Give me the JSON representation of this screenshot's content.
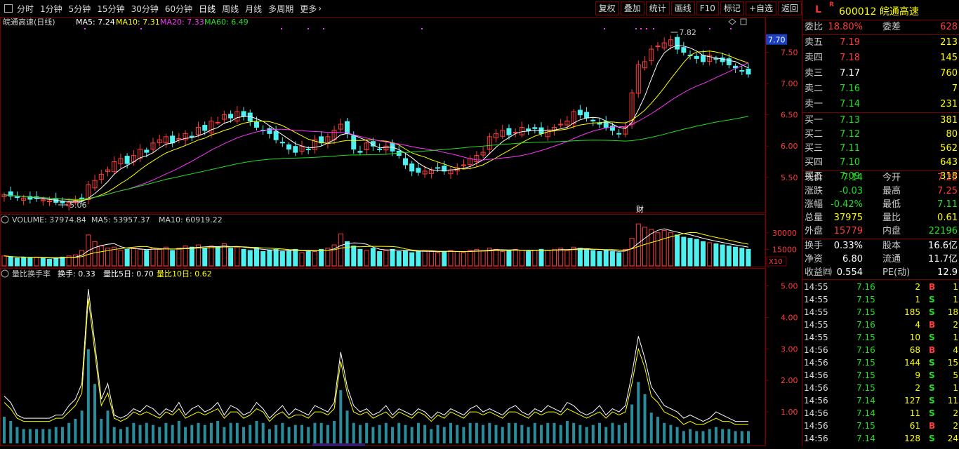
{
  "toolbar": {
    "periods": [
      "分时",
      "1分钟",
      "5分钟",
      "15分钟",
      "30分钟",
      "60分钟",
      "日线",
      "周线",
      "月线",
      "多周期",
      "更多"
    ],
    "active": "日线",
    "more_icon": "chevron-right-icon",
    "actions": [
      "复权",
      "叠加",
      "统计",
      "画线",
      "F10",
      "标记",
      "+自选",
      "返回"
    ]
  },
  "main_chart": {
    "legend_title": "皖通高速(日线)",
    "ma5": "MA5: 7.24",
    "ma10": "MA10: 7.31",
    "ma20": "MA20: 7.33",
    "ma60": "MA60: 6.49",
    "high_label": "7.82",
    "low_label": "5.06",
    "current_price_tag": "7.70",
    "yticks": [
      "7.50",
      "7.00",
      "6.50",
      "6.00",
      "5.50"
    ],
    "marker": "财",
    "colors": {
      "up": "#ff3b3b",
      "down": "#4ff0f0",
      "ma5": "#ffffff",
      "ma10": "#ffff00",
      "ma20": "#ff33ff",
      "ma60": "#22dd22"
    }
  },
  "volume_chart": {
    "legend_title": "VOLUME: 37974.84",
    "ma5": "MA5: 53957.37",
    "ma10": "MA10: 60919.22",
    "yticks": [
      "30000",
      "15000"
    ],
    "unit": "X10"
  },
  "ratio_chart": {
    "legend_title": "量比换手率",
    "turnover": "换手: 0.33",
    "ratio5": "量比5日: 0.70",
    "ratio10": "量比10日: 0.62",
    "yticks": [
      "5.00",
      "4.00",
      "3.00",
      "2.00",
      "1.00"
    ]
  },
  "quote": {
    "flag": "L",
    "r_mark": "R",
    "code_name": "600012 皖通高速",
    "weibi_label": "委比",
    "weibi": "18.80%",
    "weicha_label": "委差",
    "weicha": "628",
    "asks": [
      {
        "label": "卖五",
        "price": "7.19",
        "vol": "213",
        "color": "red"
      },
      {
        "label": "卖四",
        "price": "7.18",
        "vol": "145",
        "color": "red"
      },
      {
        "label": "卖三",
        "price": "7.17",
        "vol": "760",
        "color": "white"
      },
      {
        "label": "卖二",
        "price": "7.16",
        "vol": "7",
        "color": "green"
      },
      {
        "label": "卖一",
        "price": "7.14",
        "vol": "231",
        "color": "green"
      }
    ],
    "bids": [
      {
        "label": "买一",
        "price": "7.13",
        "vol": "381",
        "color": "green"
      },
      {
        "label": "买二",
        "price": "7.12",
        "vol": "80",
        "color": "green"
      },
      {
        "label": "买三",
        "price": "7.11",
        "vol": "562",
        "color": "green"
      },
      {
        "label": "买四",
        "price": "7.10",
        "vol": "643",
        "color": "green"
      },
      {
        "label": "买五",
        "price": "7.09",
        "vol": "318",
        "color": "green"
      }
    ],
    "stats": [
      {
        "a": "现价",
        "b": "7.14",
        "bc": "green",
        "c": "今开",
        "d": "7.22",
        "dc": "red"
      },
      {
        "a": "涨跌",
        "b": "-0.03",
        "bc": "green",
        "c": "最高",
        "d": "7.25",
        "dc": "red"
      },
      {
        "a": "涨幅",
        "b": "-0.42%",
        "bc": "green",
        "c": "最低",
        "d": "7.11",
        "dc": "green"
      },
      {
        "a": "总量",
        "b": "37975",
        "bc": "yellow",
        "c": "量比",
        "d": "0.61",
        "dc": "yellow"
      },
      {
        "a": "外盘",
        "b": "15779",
        "bc": "red",
        "c": "内盘",
        "d": "22196",
        "dc": "green"
      }
    ],
    "fundamentals": [
      {
        "a": "换手",
        "b": "0.33%",
        "c": "股本",
        "d": "16.6亿"
      },
      {
        "a": "净资",
        "b": "6.80",
        "c": "流通",
        "d": "11.7亿"
      },
      {
        "a": "收益㈣",
        "b": "0.554",
        "c": "PE(动)",
        "d": "12.9"
      }
    ],
    "ticks": [
      {
        "t": "14:55",
        "p": "7.16",
        "v": "2",
        "s": "B",
        "n": "1"
      },
      {
        "t": "14:55",
        "p": "7.15",
        "v": "1",
        "s": "S",
        "n": "1"
      },
      {
        "t": "14:55",
        "p": "7.15",
        "v": "185",
        "s": "S",
        "n": "18"
      },
      {
        "t": "14:55",
        "p": "7.16",
        "v": "4",
        "s": "B",
        "n": "2"
      },
      {
        "t": "14:55",
        "p": "7.15",
        "v": "10",
        "s": "S",
        "n": "1"
      },
      {
        "t": "14:56",
        "p": "7.16",
        "v": "68",
        "s": "B",
        "n": "4"
      },
      {
        "t": "14:56",
        "p": "7.15",
        "v": "144",
        "s": "S",
        "n": "15"
      },
      {
        "t": "14:56",
        "p": "7.15",
        "v": "9",
        "s": "S",
        "n": "5"
      },
      {
        "t": "14:56",
        "p": "7.15",
        "v": "2",
        "s": "S",
        "n": "1"
      },
      {
        "t": "14:56",
        "p": "7.14",
        "v": "127",
        "s": "S",
        "n": "11"
      },
      {
        "t": "14:56",
        "p": "7.14",
        "v": "11",
        "s": "S",
        "n": "2"
      },
      {
        "t": "14:56",
        "p": "7.15",
        "v": "61",
        "s": "B",
        "n": "2"
      },
      {
        "t": "14:56",
        "p": "7.14",
        "v": "128",
        "s": "S",
        "n": "24"
      }
    ]
  },
  "chart_data": {
    "type": "candlestick",
    "ylim": [
      5.06,
      7.82
    ],
    "ma_values": {
      "MA5": 7.24,
      "MA10": 7.31,
      "MA20": 7.33,
      "MA60": 6.49
    },
    "close": [
      5.22,
      5.2,
      5.18,
      5.17,
      5.15,
      5.16,
      5.14,
      5.12,
      5.1,
      5.09,
      5.1,
      5.12,
      5.15,
      5.38,
      5.45,
      5.55,
      5.62,
      5.75,
      5.8,
      5.72,
      5.85,
      5.95,
      5.9,
      6.05,
      6.1,
      6.15,
      6.05,
      6.12,
      6.2,
      6.15,
      6.3,
      6.25,
      6.4,
      6.38,
      6.5,
      6.45,
      6.55,
      6.48,
      6.4,
      6.3,
      6.25,
      6.2,
      6.1,
      6.05,
      5.95,
      5.9,
      6.0,
      5.95,
      6.1,
      6.05,
      6.15,
      6.25,
      6.35,
      6.2,
      5.95,
      5.9,
      6.05,
      6.0,
      5.95,
      6.0,
      5.92,
      5.85,
      5.7,
      5.6,
      5.58,
      5.6,
      5.62,
      5.65,
      5.6,
      5.62,
      5.65,
      5.7,
      5.8,
      5.85,
      5.9,
      6.15,
      6.2,
      6.25,
      6.18,
      6.22,
      6.3,
      6.25,
      6.28,
      6.2,
      6.25,
      6.3,
      6.35,
      6.4,
      6.55,
      6.5,
      6.45,
      6.4,
      6.35,
      6.3,
      6.25,
      6.2,
      6.3,
      6.85,
      7.3,
      7.35,
      7.55,
      7.6,
      7.65,
      7.7,
      7.55,
      7.5,
      7.45,
      7.4,
      7.35,
      7.45,
      7.4,
      7.35,
      7.3,
      7.25,
      7.2,
      7.15
    ],
    "volume": [
      9,
      8,
      7,
      8,
      7,
      8,
      7,
      6,
      7,
      8,
      9,
      10,
      14,
      28,
      22,
      18,
      16,
      17,
      14,
      15,
      16,
      15,
      14,
      16,
      15,
      17,
      14,
      16,
      18,
      17,
      19,
      16,
      18,
      17,
      20,
      16,
      17,
      15,
      14,
      16,
      13,
      14,
      15,
      13,
      14,
      15,
      12,
      14,
      13,
      15,
      16,
      19,
      29,
      22,
      18,
      15,
      14,
      16,
      13,
      14,
      15,
      13,
      14,
      12,
      13,
      14,
      13,
      12,
      13,
      14,
      13,
      12,
      14,
      15,
      14,
      16,
      15,
      13,
      14,
      15,
      14,
      13,
      14,
      15,
      14,
      15,
      16,
      14,
      17,
      16,
      15,
      14,
      13,
      14,
      13,
      12,
      15,
      25,
      38,
      35,
      33,
      30,
      32,
      30,
      28,
      26,
      25,
      24,
      22,
      21,
      20,
      19,
      18,
      17,
      16,
      15
    ],
    "ratio_series": [
      {
        "name": "量比5日",
        "values": [
          1.5,
          1.3,
          0.9,
          0.8,
          0.8,
          0.8,
          0.8,
          0.8,
          0.9,
          0.9,
          1.2,
          1.4,
          1.9,
          4.9,
          3.2,
          1.4,
          1.9,
          0.9,
          0.8,
          0.9,
          1.1,
          1.0,
          1.2,
          1.1,
          0.9,
          1.1,
          1.0,
          1.3,
          0.9,
          1.1,
          1.2,
          1.0,
          1.1,
          1.3,
          0.9,
          1.2,
          1.1,
          0.9,
          1.0,
          1.3,
          1.1,
          0.8,
          1.0,
          1.2,
          0.9,
          1.1,
          1.0,
          0.9,
          1.2,
          1.1,
          1.0,
          1.3,
          2.9,
          1.8,
          1.2,
          1.0,
          1.1,
          0.9,
          1.0,
          1.2,
          0.9,
          1.1,
          1.0,
          0.9,
          1.1,
          1.0,
          0.8,
          1.0,
          0.9,
          1.1,
          1.0,
          0.9,
          1.1,
          1.2,
          1.0,
          1.1,
          1.0,
          0.9,
          1.1,
          1.2,
          1.0,
          0.9,
          1.1,
          1.0,
          1.2,
          1.1,
          1.0,
          1.3,
          1.2,
          1.0,
          0.9,
          1.0,
          1.2,
          0.9,
          1.1,
          1.0,
          1.2,
          2.2,
          3.4,
          2.7,
          1.8,
          1.5,
          1.2,
          1.1,
          1.0,
          0.8,
          0.9,
          0.8,
          0.7,
          0.8,
          1.0,
          0.9,
          0.8,
          0.7,
          0.7,
          0.7
        ]
      },
      {
        "name": "量比10日",
        "values": [
          1.3,
          1.1,
          0.8,
          0.7,
          0.7,
          0.7,
          0.7,
          0.7,
          0.8,
          0.8,
          1.0,
          1.2,
          1.6,
          4.6,
          2.9,
          1.2,
          1.6,
          0.8,
          0.7,
          0.8,
          1.0,
          0.9,
          1.0,
          0.9,
          0.8,
          1.0,
          0.9,
          1.1,
          0.8,
          0.9,
          1.0,
          0.9,
          1.0,
          1.1,
          0.8,
          1.0,
          1.0,
          0.8,
          0.9,
          1.1,
          1.0,
          0.7,
          0.9,
          1.0,
          0.8,
          0.9,
          0.9,
          0.8,
          1.0,
          1.0,
          0.9,
          1.1,
          2.6,
          1.6,
          1.0,
          0.9,
          1.0,
          0.8,
          0.9,
          1.0,
          0.8,
          1.0,
          0.9,
          0.8,
          1.0,
          0.9,
          0.7,
          0.9,
          0.8,
          1.0,
          0.9,
          0.8,
          1.0,
          1.0,
          0.9,
          1.0,
          0.9,
          0.8,
          1.0,
          1.0,
          0.9,
          0.8,
          1.0,
          0.9,
          1.0,
          1.0,
          0.9,
          1.1,
          1.0,
          0.9,
          0.8,
          0.9,
          1.0,
          0.8,
          1.0,
          0.9,
          1.0,
          1.9,
          3.0,
          2.4,
          1.5,
          1.3,
          1.0,
          0.9,
          0.8,
          0.6,
          0.7,
          0.6,
          0.6,
          0.7,
          0.8,
          0.7,
          0.7,
          0.6,
          0.6,
          0.6
        ]
      }
    ]
  }
}
